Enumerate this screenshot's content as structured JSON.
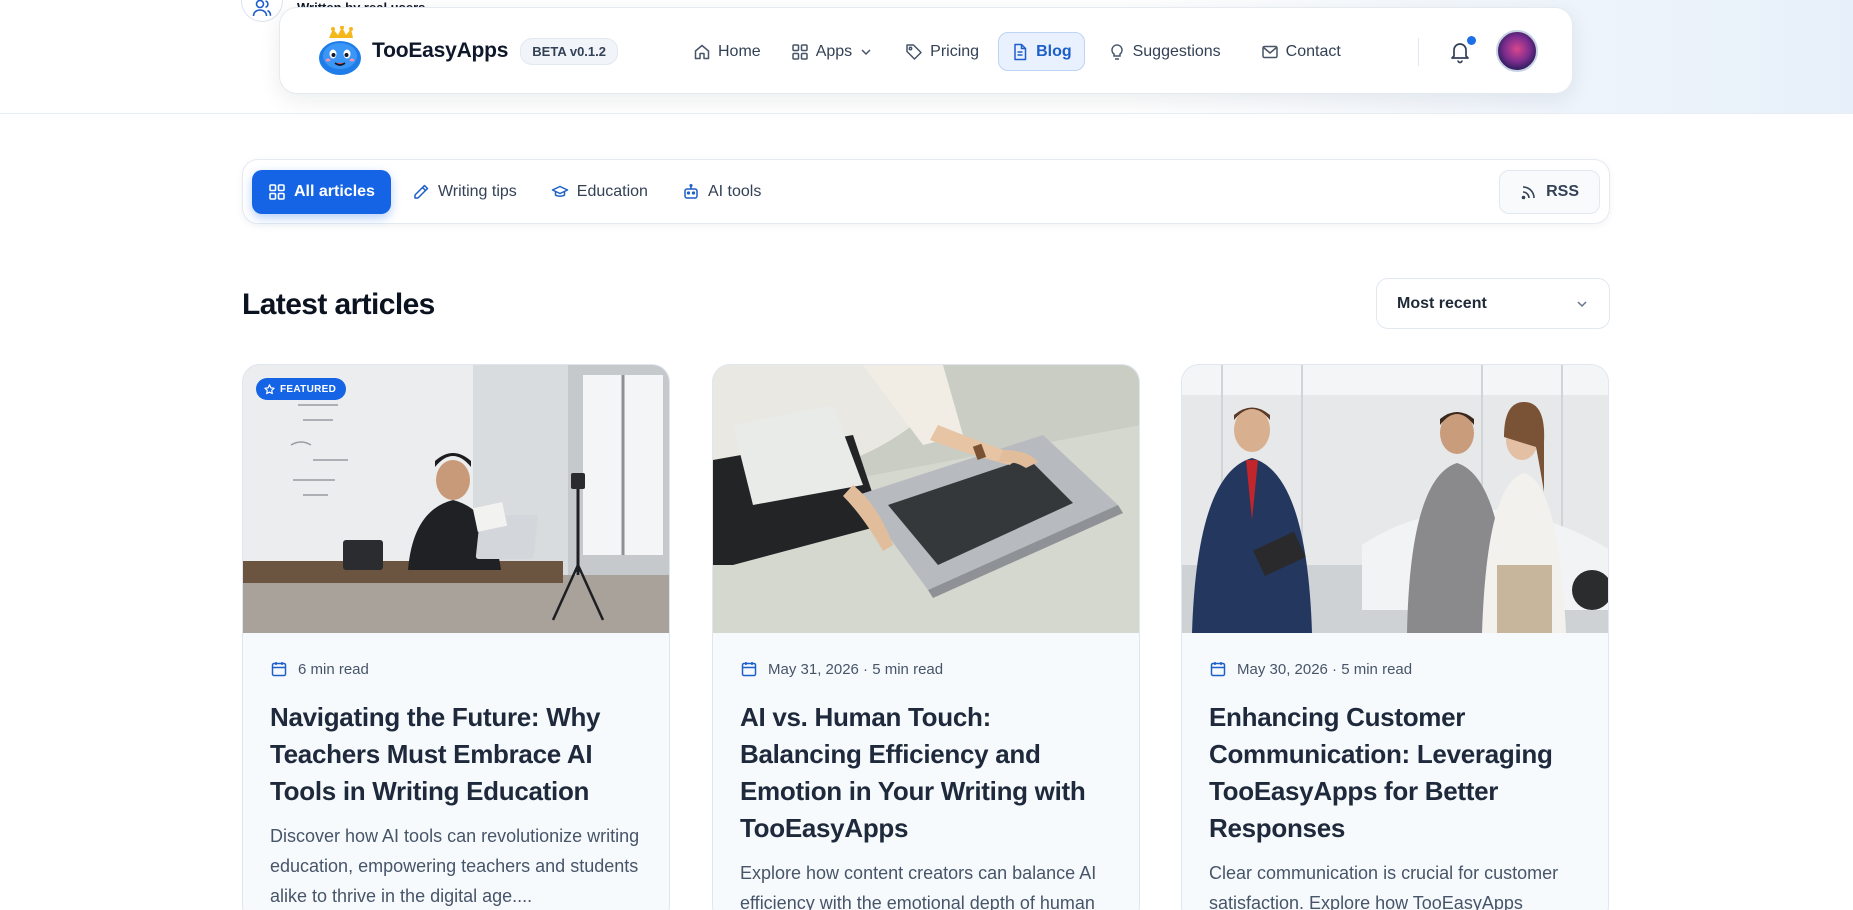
{
  "peek": {
    "text": "Written by real users"
  },
  "navbar": {
    "brand": "TooEasyApps",
    "badge": "BETA v0.1.2",
    "items": [
      {
        "label": "Home",
        "icon": "home-icon"
      },
      {
        "label": "Apps",
        "icon": "grid-icon"
      },
      {
        "label": "Pricing",
        "icon": "tag-icon"
      },
      {
        "label": "Blog",
        "icon": "document-icon"
      },
      {
        "label": "Suggestions",
        "icon": "lightbulb-icon"
      },
      {
        "label": "Contact",
        "icon": "mail-icon"
      }
    ],
    "active": "Blog"
  },
  "filters": {
    "items": [
      {
        "label": "All articles",
        "icon": "grid-icon"
      },
      {
        "label": "Writing tips",
        "icon": "pencil-icon"
      },
      {
        "label": "Education",
        "icon": "graduation-cap-icon"
      },
      {
        "label": "AI tools",
        "icon": "robot-icon"
      }
    ],
    "active": "All articles",
    "rss": "RSS"
  },
  "section": {
    "title": "Latest articles"
  },
  "sort": {
    "selected": "Most recent"
  },
  "articles": [
    {
      "badge": "FEATURED",
      "meta": "6 min read",
      "title": "Navigating the Future: Why Teachers Must Embrace AI Tools in Writing Education",
      "desc": "Discover how AI tools can revolutionize writing education, empowering teachers and students alike to thrive in the digital age...."
    },
    {
      "meta": "May 31, 2026 · 5 min read",
      "title": "AI vs. Human Touch: Balancing Efficiency and Emotion in Your Writing with TooEasyApps",
      "desc": "Explore how content creators can balance AI efficiency with the emotional depth of human"
    },
    {
      "meta": "May 30, 2026 · 5 min read",
      "title": "Enhancing Customer Communication: Leveraging TooEasyApps for Better Responses",
      "desc": "Clear communication is crucial for customer satisfaction. Explore how TooEasyApps"
    }
  ],
  "colors": {
    "accent": "#1564e6",
    "active_nav_bg": "#e8f1fd"
  }
}
